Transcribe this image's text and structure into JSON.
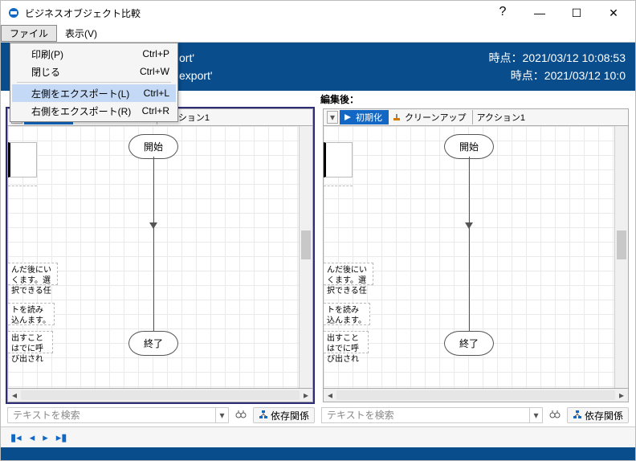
{
  "window": {
    "title": "ビジネスオブジェクト比較",
    "help": "?",
    "minimize": "—",
    "maximize": "☐",
    "close": "✕"
  },
  "menubar": {
    "file": "ファイル",
    "view": "表示(V)"
  },
  "file_menu": {
    "print": {
      "label": "印刷(P)",
      "shortcut": "Ctrl+P"
    },
    "close": {
      "label": "閉じる",
      "shortcut": "Ctrl+W"
    },
    "export_left": {
      "label": "左側をエクスポート(L)",
      "shortcut": "Ctrl+L"
    },
    "export_right": {
      "label": "右側をエクスポート(R)",
      "shortcut": "Ctrl+R"
    }
  },
  "banner": {
    "left_suffix1": "ort'",
    "left_suffix2": "export'",
    "right1_label": "時点：",
    "right1_value": "2021/03/12 10:08:53",
    "right2_label": "時点：",
    "right2_value": "2021/03/12 10:0"
  },
  "pane_header": {
    "left": "",
    "right": "編集後："
  },
  "tabs": {
    "init": "初期化",
    "cleanup": "クリーンアップ",
    "action1": "アクション1"
  },
  "flow": {
    "start": "開始",
    "end": "終了"
  },
  "cut_text": {
    "c2": "んだ後にいくます。選択できる任",
    "c3": "トを読み込んます。",
    "c4": "出すことはでに呼び出され"
  },
  "search": {
    "placeholder": "テキストを検索",
    "deps": "依存関係"
  }
}
